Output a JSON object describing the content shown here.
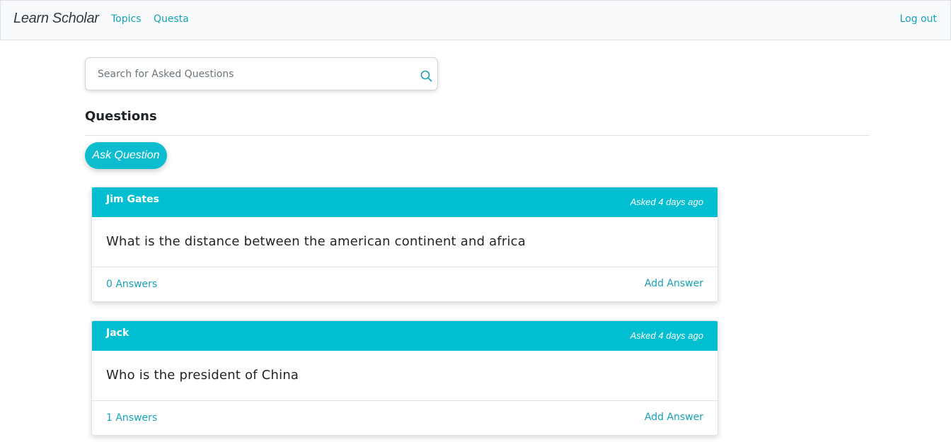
{
  "navbar": {
    "brand": "Learn Scholar",
    "links": [
      "Topics",
      "Questa"
    ],
    "logout": "Log out"
  },
  "search": {
    "placeholder": "Search for Asked Questions",
    "value": "",
    "icon": "search-icon"
  },
  "section": {
    "title": "Questions"
  },
  "ask_button": {
    "label": "Ask Question"
  },
  "questions": [
    {
      "author": "Jim Gates",
      "asked": "Asked 4 days ago",
      "text": "What is the distance between the american continent and africa",
      "answers": "0 Answers",
      "add_answer": "Add Answer"
    },
    {
      "author": "Jack",
      "asked": "Asked 4 days ago",
      "text": "Who is the president of China",
      "answers": "1 Answers",
      "add_answer": "Add Answer"
    }
  ],
  "colors": {
    "accent": "#17a2b8",
    "card_header": "#02bed1",
    "button": "#0dbccf",
    "navbar_bg": "#f8f9fa"
  }
}
